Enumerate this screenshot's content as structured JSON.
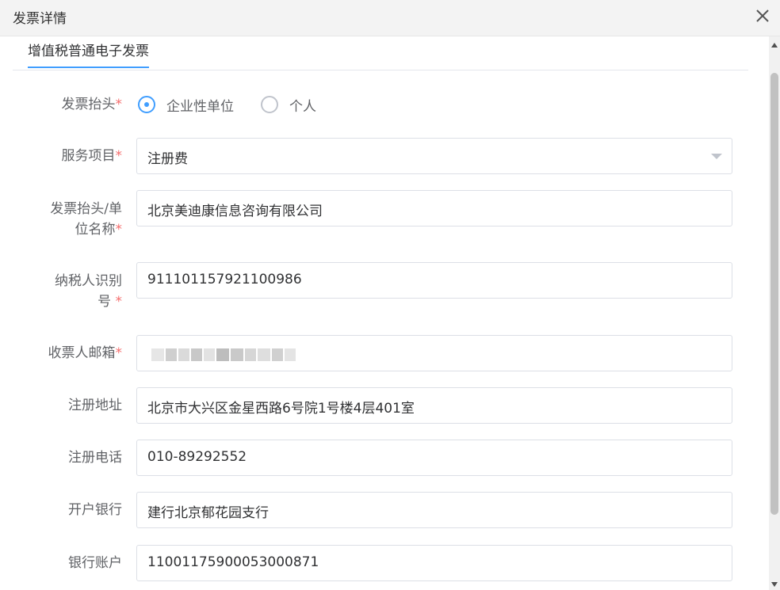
{
  "dialog": {
    "title": "发票详情",
    "close_icon": "close-icon"
  },
  "tabs": [
    {
      "label": "增值税普通电子发票",
      "active": true
    }
  ],
  "colors": {
    "accent": "#409eff",
    "required": "#f56c6c",
    "label": "#606266",
    "border": "#dcdfe6"
  },
  "form": {
    "invoice_header": {
      "label": "发票抬头",
      "required_mark": "*",
      "options": [
        {
          "label": "企业性单位",
          "checked": true
        },
        {
          "label": "个人",
          "checked": false
        }
      ]
    },
    "service_item": {
      "label": "服务项目",
      "required_mark": "*",
      "value": "注册费"
    },
    "company_name": {
      "label_line1": "发票抬头/单",
      "label_line2": "位名称",
      "required_mark": "*",
      "value": "北京美迪康信息咨询有限公司"
    },
    "taxpayer_id": {
      "label_line1": "纳税人识别",
      "label_line2": "号 ",
      "required_mark": "*",
      "value": "911101157921100986"
    },
    "recipient_email": {
      "label": "收票人邮箱",
      "required_mark": "*",
      "value": ""
    },
    "registered_address": {
      "label": "注册地址",
      "value": "北京市大兴区金星西路6号院1号楼4层401室"
    },
    "registered_phone": {
      "label": "注册电话",
      "value": "010-89292552"
    },
    "bank": {
      "label": "开户银行",
      "value": "建行北京郁花园支行"
    },
    "bank_account": {
      "label": "银行账户",
      "value": "1100117590005300087​1"
    }
  }
}
